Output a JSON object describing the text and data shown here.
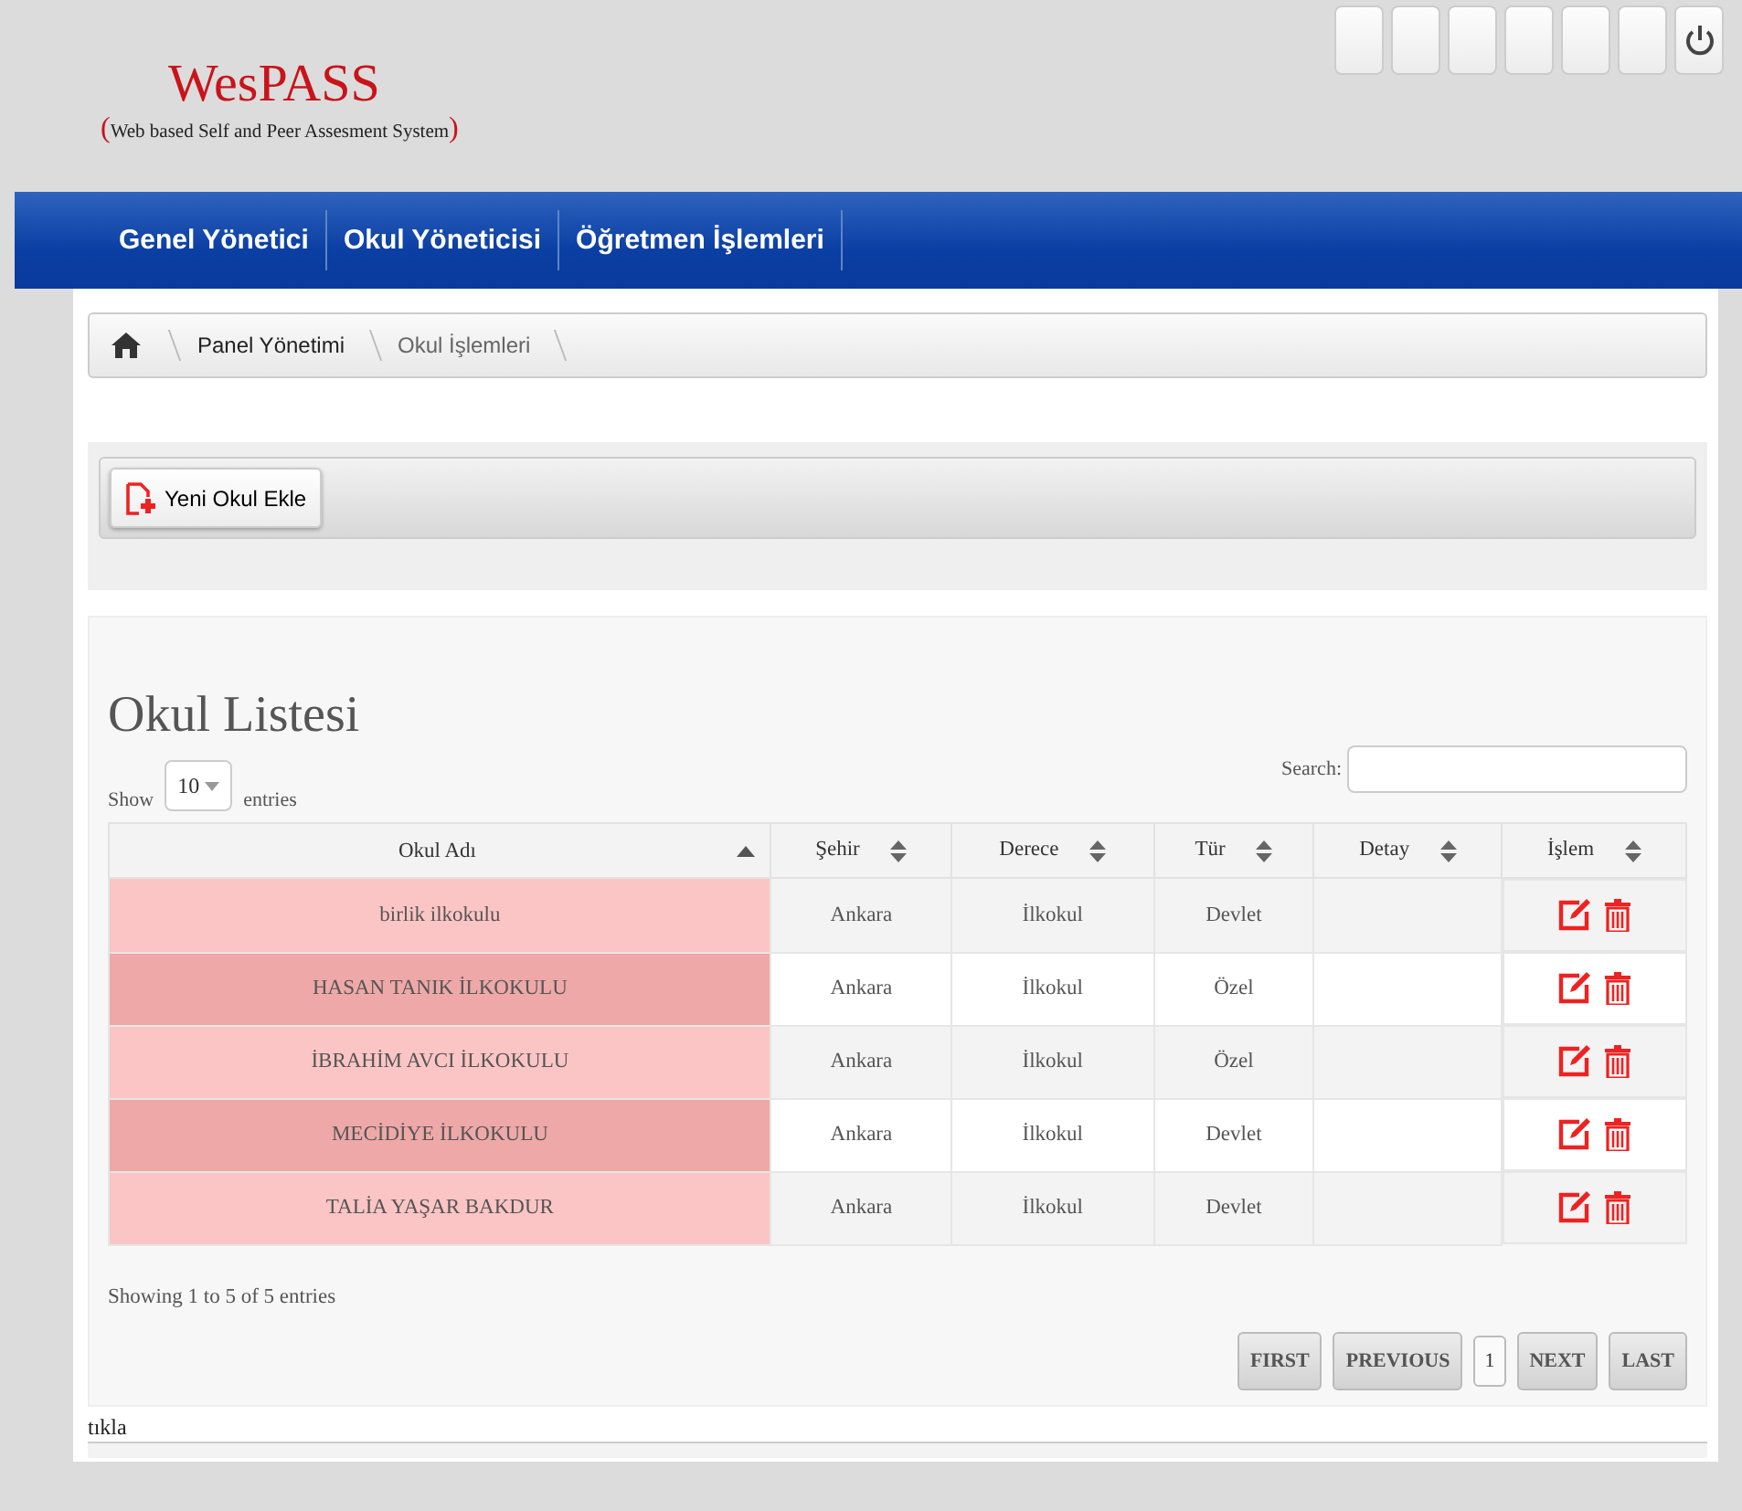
{
  "logo": {
    "title": "WesPASS",
    "subtitle": "(Web based Self and Peer  Assesment System)"
  },
  "nav": {
    "items": [
      "Genel Yönetici",
      "Okul Yöneticisi",
      "Öğretmen İşlemleri"
    ]
  },
  "breadcrumb": [
    "Panel Yönetimi",
    "Okul İşlemleri"
  ],
  "add_button": "Yeni Okul Ekle",
  "list": {
    "title": "Okul Listesi",
    "show_label": "Show",
    "page_size": "10",
    "entries_label": "entries",
    "search_label": "Search:",
    "columns": [
      {
        "label": "Okul Adı",
        "sorted": true
      },
      {
        "label": "Şehir",
        "sorted": false
      },
      {
        "label": "Derece",
        "sorted": false
      },
      {
        "label": "Tür",
        "sorted": false
      },
      {
        "label": "Detay",
        "sorted": false
      },
      {
        "label": "İşlem",
        "sorted": false
      }
    ],
    "rows": [
      {
        "name": "birlik ilkokulu",
        "city": "Ankara",
        "level": "İlkokul",
        "type": "Devlet",
        "detail": ""
      },
      {
        "name": "HASAN TANIK İLKOKULU",
        "city": "Ankara",
        "level": "İlkokul",
        "type": "Özel",
        "detail": ""
      },
      {
        "name": "İBRAHİM AVCI İLKOKULU",
        "city": "Ankara",
        "level": "İlkokul",
        "type": "Özel",
        "detail": ""
      },
      {
        "name": "MECİDİYE İLKOKULU",
        "city": "Ankara",
        "level": "İlkokul",
        "type": "Devlet",
        "detail": ""
      },
      {
        "name": "TALİA YAŞAR BAKDUR",
        "city": "Ankara",
        "level": "İlkokul",
        "type": "Devlet",
        "detail": ""
      }
    ],
    "info": "Showing 1 to 5 of 5 entries",
    "pagination": [
      {
        "label": "FIRST",
        "kind": "nav"
      },
      {
        "label": "PREVIOUS",
        "kind": "nav"
      },
      {
        "label": "1",
        "kind": "page"
      },
      {
        "label": "NEXT",
        "kind": "nav"
      },
      {
        "label": "LAST",
        "kind": "nav"
      }
    ]
  },
  "footer_text": "tıkla"
}
